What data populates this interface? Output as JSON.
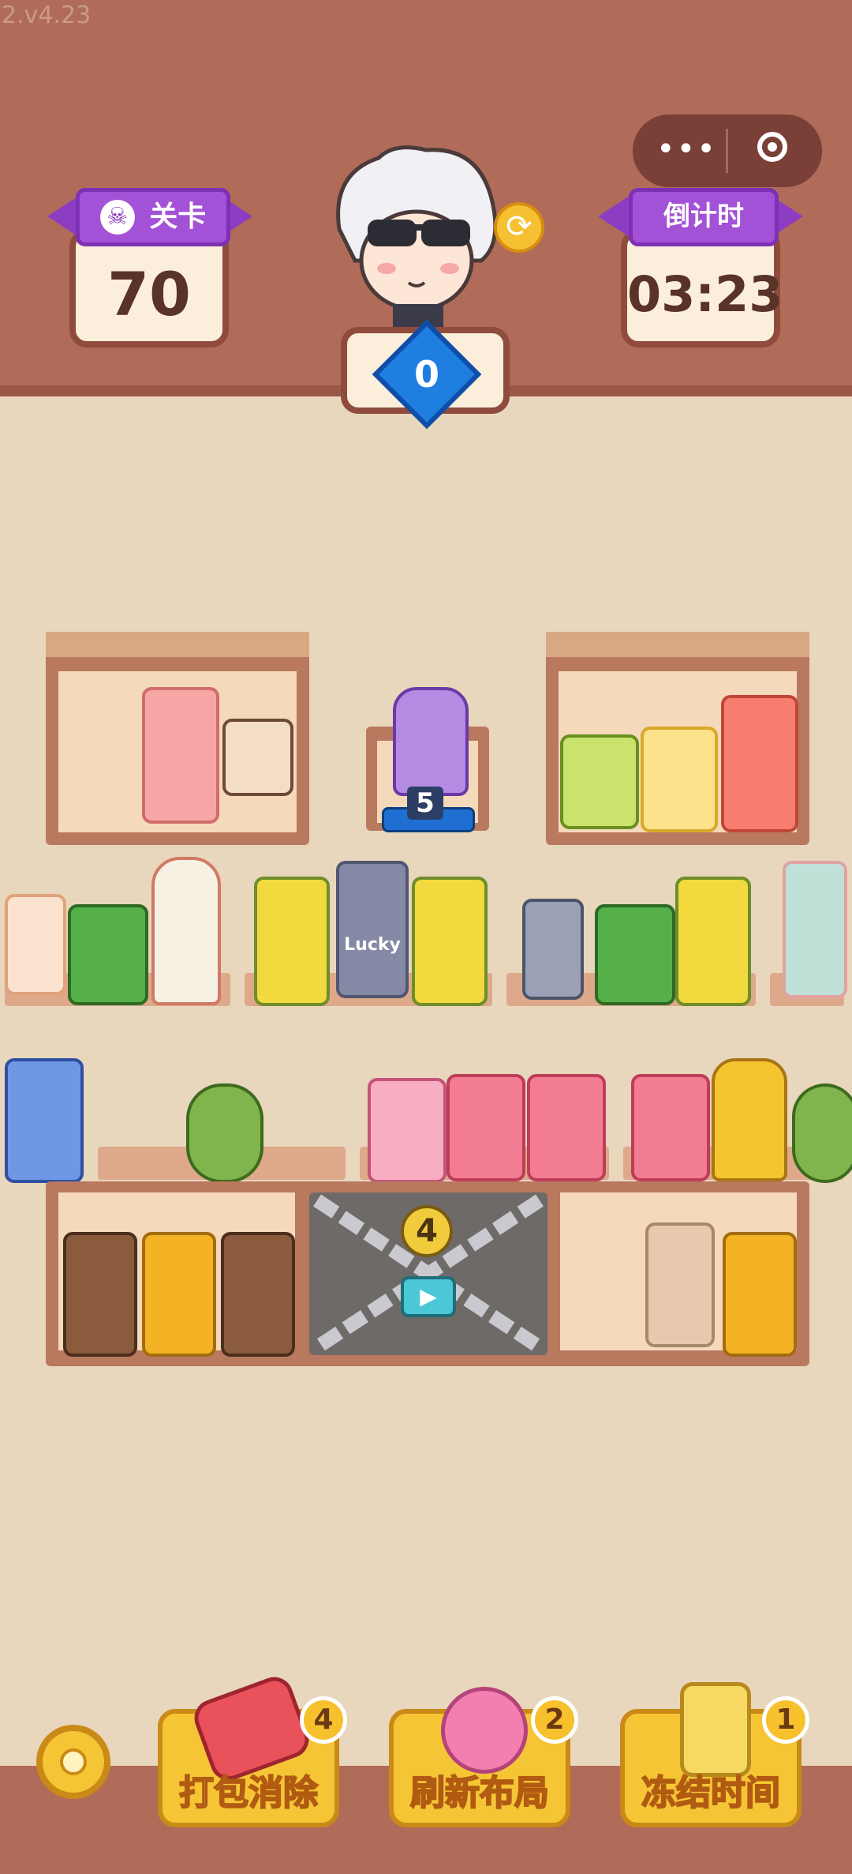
{
  "version": "2.v4.23",
  "header": {
    "level_label": "关卡",
    "level_value": "70",
    "timer_label": "倒计时",
    "timer_value": "03:23",
    "gems": "0"
  },
  "capsule": {
    "more_icon": "more-dots-icon",
    "close_icon": "target-icon"
  },
  "shelves": {
    "center_stack_count": "5",
    "locked_slot_count": "4",
    "cup_label": "Lucky"
  },
  "tools": [
    {
      "label": "打包消除",
      "count": "4",
      "icon": "pack-can-icon"
    },
    {
      "label": "刷新布局",
      "count": "2",
      "icon": "pinwheel-icon"
    },
    {
      "label": "冻结时间",
      "count": "1",
      "icon": "hourglass-icon"
    }
  ],
  "colors": {
    "top_bar": "#b06b59",
    "background": "#e8d6bd",
    "ribbon": "#a351d6",
    "tool_button": "#f5c535"
  }
}
